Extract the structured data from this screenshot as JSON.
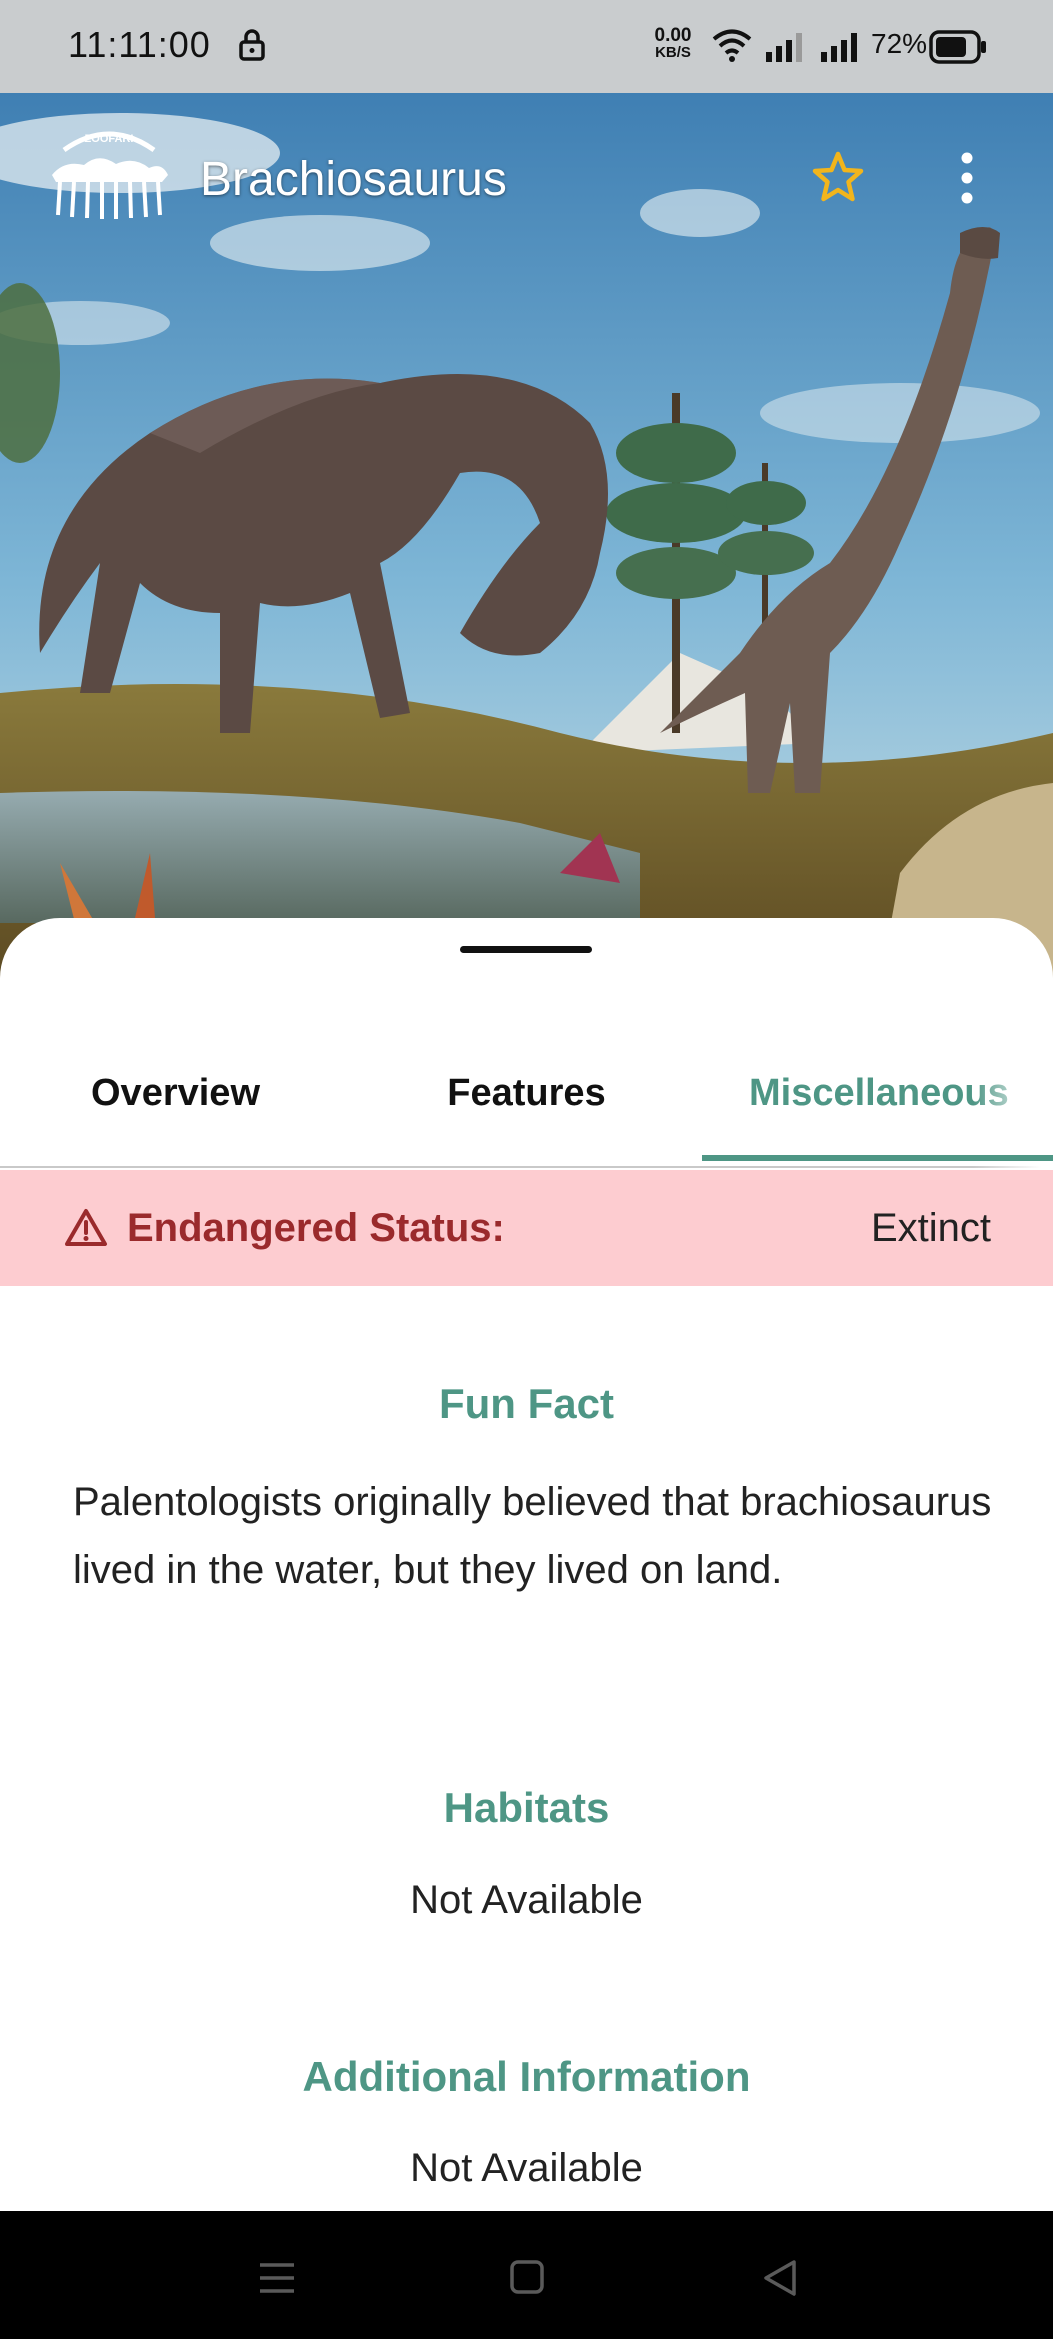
{
  "status_bar": {
    "time": "11:11:00",
    "net_speed_value": "0.00",
    "net_speed_unit": "KB/S",
    "battery_percent": "72%"
  },
  "app_bar": {
    "logo_text": "ZOOFARI",
    "title": "Brachiosaurus"
  },
  "tabs": [
    {
      "label": "Overview",
      "selected": false
    },
    {
      "label": "Features",
      "selected": false
    },
    {
      "label": "Miscellaneous",
      "selected": true
    }
  ],
  "endangered": {
    "label": "Endangered Status:",
    "value": "Extinct"
  },
  "sections": {
    "fun_fact": {
      "title": "Fun Fact",
      "text": "Palentologists originally believed that brachiosaurus lived in the water, but they lived on land."
    },
    "habitats": {
      "title": "Habitats",
      "text": "Not Available"
    },
    "additional": {
      "title": "Additional Information",
      "text": "Not Available"
    }
  },
  "colors": {
    "accent": "#4e9685",
    "danger_text": "#9a2a2c",
    "danger_bg": "#fdccd0",
    "star": "#f2b51c"
  },
  "icons": {
    "lock": "lock-icon",
    "wifi": "wifi-icon",
    "signal": "signal-icon",
    "battery": "battery-icon",
    "favorite": "star-outline-icon",
    "more": "more-vertical-icon",
    "warning": "warning-triangle-icon",
    "nav_menu": "menu-icon",
    "nav_home": "home-square-icon",
    "nav_back": "back-triangle-icon"
  }
}
